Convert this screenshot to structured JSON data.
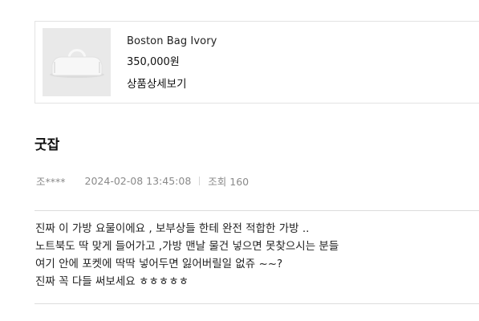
{
  "product": {
    "name": "Boston Bag Ivory",
    "price": "350,000원",
    "detail_link": "상품상세보기",
    "thumb_icon": "white-boston-bag-image",
    "thumb_bg": "#e9e9e9"
  },
  "review": {
    "title": "굿잡",
    "author": "조****",
    "date": "2024-02-08 13:45:08",
    "views": "조회 160",
    "body_lines": [
      "진짜 이 가방 요물이에요 , 보부상들 한테 완전 적합한 가방 ..",
      "노트북도 딱 맞게 들어가고 ,가방 맨날 물건 넣으면 못찾으시는 분들",
      "여기 안에 포켓에 딱딱 넣어두면 잃어버릴일 없쥬 ~~?",
      "진짜 꼭 다들 써보세요 ㅎㅎㅎㅎㅎ"
    ]
  }
}
